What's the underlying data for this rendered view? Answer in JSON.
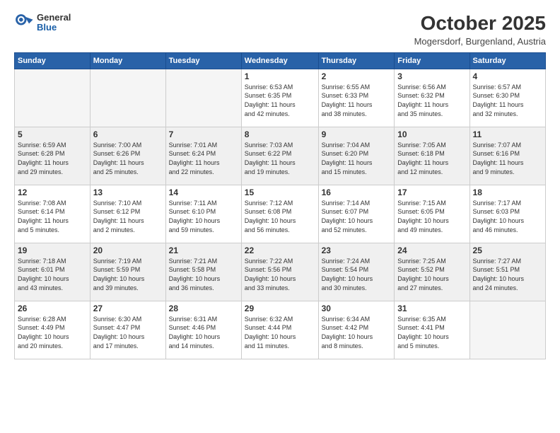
{
  "logo": {
    "general": "General",
    "blue": "Blue"
  },
  "header": {
    "month": "October 2025",
    "location": "Mogersdorf, Burgenland, Austria"
  },
  "weekdays": [
    "Sunday",
    "Monday",
    "Tuesday",
    "Wednesday",
    "Thursday",
    "Friday",
    "Saturday"
  ],
  "weeks": [
    [
      {
        "day": "",
        "info": ""
      },
      {
        "day": "",
        "info": ""
      },
      {
        "day": "",
        "info": ""
      },
      {
        "day": "1",
        "info": "Sunrise: 6:53 AM\nSunset: 6:35 PM\nDaylight: 11 hours\nand 42 minutes."
      },
      {
        "day": "2",
        "info": "Sunrise: 6:55 AM\nSunset: 6:33 PM\nDaylight: 11 hours\nand 38 minutes."
      },
      {
        "day": "3",
        "info": "Sunrise: 6:56 AM\nSunset: 6:32 PM\nDaylight: 11 hours\nand 35 minutes."
      },
      {
        "day": "4",
        "info": "Sunrise: 6:57 AM\nSunset: 6:30 PM\nDaylight: 11 hours\nand 32 minutes."
      }
    ],
    [
      {
        "day": "5",
        "info": "Sunrise: 6:59 AM\nSunset: 6:28 PM\nDaylight: 11 hours\nand 29 minutes."
      },
      {
        "day": "6",
        "info": "Sunrise: 7:00 AM\nSunset: 6:26 PM\nDaylight: 11 hours\nand 25 minutes."
      },
      {
        "day": "7",
        "info": "Sunrise: 7:01 AM\nSunset: 6:24 PM\nDaylight: 11 hours\nand 22 minutes."
      },
      {
        "day": "8",
        "info": "Sunrise: 7:03 AM\nSunset: 6:22 PM\nDaylight: 11 hours\nand 19 minutes."
      },
      {
        "day": "9",
        "info": "Sunrise: 7:04 AM\nSunset: 6:20 PM\nDaylight: 11 hours\nand 15 minutes."
      },
      {
        "day": "10",
        "info": "Sunrise: 7:05 AM\nSunset: 6:18 PM\nDaylight: 11 hours\nand 12 minutes."
      },
      {
        "day": "11",
        "info": "Sunrise: 7:07 AM\nSunset: 6:16 PM\nDaylight: 11 hours\nand 9 minutes."
      }
    ],
    [
      {
        "day": "12",
        "info": "Sunrise: 7:08 AM\nSunset: 6:14 PM\nDaylight: 11 hours\nand 5 minutes."
      },
      {
        "day": "13",
        "info": "Sunrise: 7:10 AM\nSunset: 6:12 PM\nDaylight: 11 hours\nand 2 minutes."
      },
      {
        "day": "14",
        "info": "Sunrise: 7:11 AM\nSunset: 6:10 PM\nDaylight: 10 hours\nand 59 minutes."
      },
      {
        "day": "15",
        "info": "Sunrise: 7:12 AM\nSunset: 6:08 PM\nDaylight: 10 hours\nand 56 minutes."
      },
      {
        "day": "16",
        "info": "Sunrise: 7:14 AM\nSunset: 6:07 PM\nDaylight: 10 hours\nand 52 minutes."
      },
      {
        "day": "17",
        "info": "Sunrise: 7:15 AM\nSunset: 6:05 PM\nDaylight: 10 hours\nand 49 minutes."
      },
      {
        "day": "18",
        "info": "Sunrise: 7:17 AM\nSunset: 6:03 PM\nDaylight: 10 hours\nand 46 minutes."
      }
    ],
    [
      {
        "day": "19",
        "info": "Sunrise: 7:18 AM\nSunset: 6:01 PM\nDaylight: 10 hours\nand 43 minutes."
      },
      {
        "day": "20",
        "info": "Sunrise: 7:19 AM\nSunset: 5:59 PM\nDaylight: 10 hours\nand 39 minutes."
      },
      {
        "day": "21",
        "info": "Sunrise: 7:21 AM\nSunset: 5:58 PM\nDaylight: 10 hours\nand 36 minutes."
      },
      {
        "day": "22",
        "info": "Sunrise: 7:22 AM\nSunset: 5:56 PM\nDaylight: 10 hours\nand 33 minutes."
      },
      {
        "day": "23",
        "info": "Sunrise: 7:24 AM\nSunset: 5:54 PM\nDaylight: 10 hours\nand 30 minutes."
      },
      {
        "day": "24",
        "info": "Sunrise: 7:25 AM\nSunset: 5:52 PM\nDaylight: 10 hours\nand 27 minutes."
      },
      {
        "day": "25",
        "info": "Sunrise: 7:27 AM\nSunset: 5:51 PM\nDaylight: 10 hours\nand 24 minutes."
      }
    ],
    [
      {
        "day": "26",
        "info": "Sunrise: 6:28 AM\nSunset: 4:49 PM\nDaylight: 10 hours\nand 20 minutes."
      },
      {
        "day": "27",
        "info": "Sunrise: 6:30 AM\nSunset: 4:47 PM\nDaylight: 10 hours\nand 17 minutes."
      },
      {
        "day": "28",
        "info": "Sunrise: 6:31 AM\nSunset: 4:46 PM\nDaylight: 10 hours\nand 14 minutes."
      },
      {
        "day": "29",
        "info": "Sunrise: 6:32 AM\nSunset: 4:44 PM\nDaylight: 10 hours\nand 11 minutes."
      },
      {
        "day": "30",
        "info": "Sunrise: 6:34 AM\nSunset: 4:42 PM\nDaylight: 10 hours\nand 8 minutes."
      },
      {
        "day": "31",
        "info": "Sunrise: 6:35 AM\nSunset: 4:41 PM\nDaylight: 10 hours\nand 5 minutes."
      },
      {
        "day": "",
        "info": ""
      }
    ]
  ]
}
